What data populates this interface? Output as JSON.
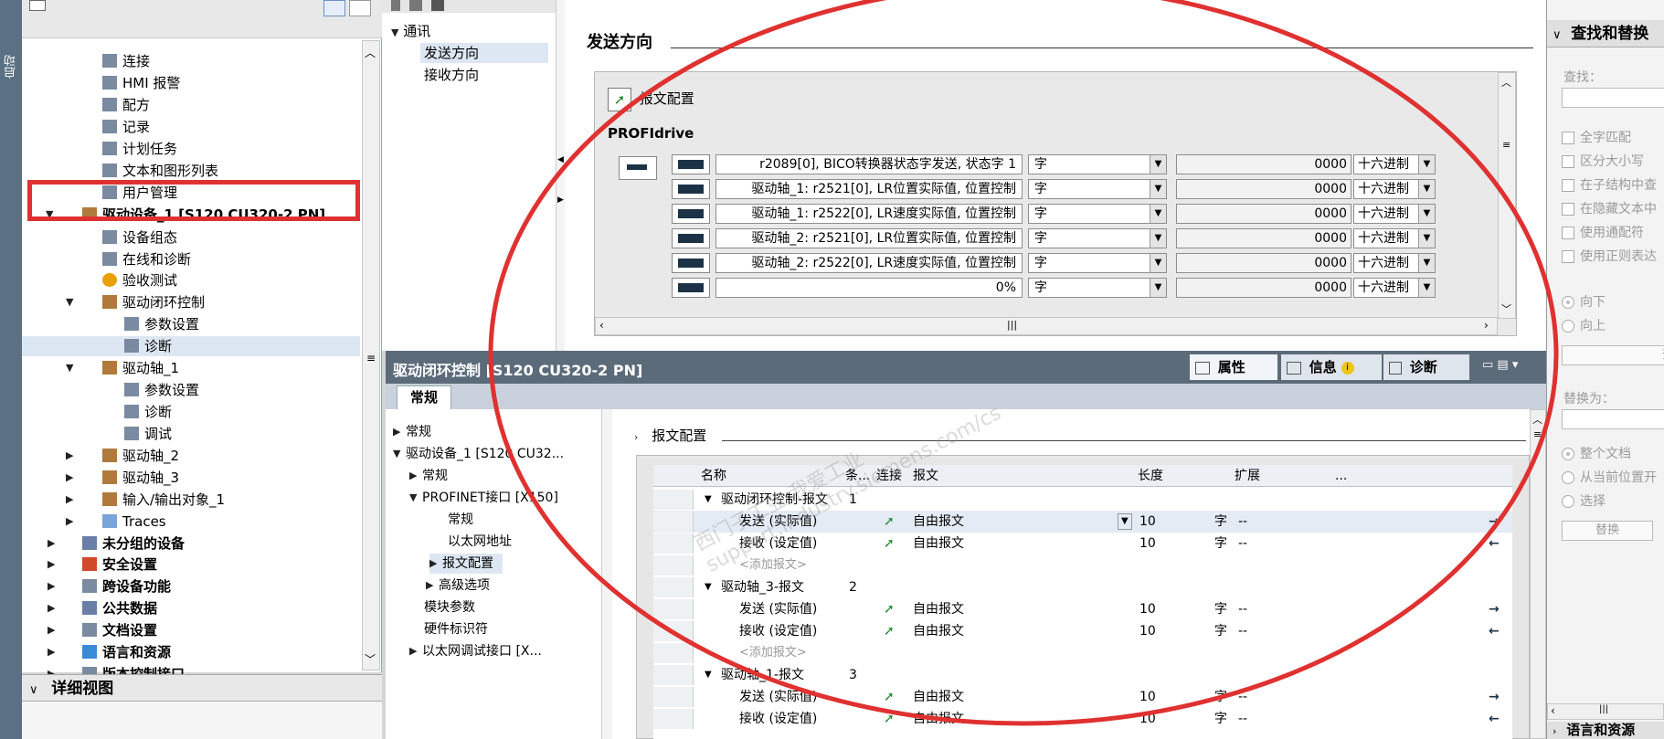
{
  "left_strip": {
    "label": "启动"
  },
  "tree": {
    "items": [
      {
        "label": "连接",
        "icon": "connection-icon"
      },
      {
        "label": "HMI 报警",
        "icon": "alarm-icon"
      },
      {
        "label": "配方",
        "icon": "recipe-icon"
      },
      {
        "label": "记录",
        "icon": "log-icon"
      },
      {
        "label": "计划任务",
        "icon": "schedule-icon"
      },
      {
        "label": "文本和图形列表",
        "icon": "textlist-icon"
      },
      {
        "label": "用户管理",
        "icon": "user-icon"
      },
      {
        "label": "驱动设备_1 [S120 CU320-2 PN]",
        "icon": "drive-device-icon"
      },
      {
        "label": "设备组态",
        "icon": "device-config-icon"
      },
      {
        "label": "在线和诊断",
        "icon": "online-diag-icon"
      },
      {
        "label": "验收测试",
        "icon": "acceptance-test-icon"
      },
      {
        "label": "驱动闭环控制",
        "icon": "drive-control-icon"
      },
      {
        "label": "参数设置",
        "icon": "parameter-icon"
      },
      {
        "label": "诊断",
        "icon": "diagnostics-icon"
      },
      {
        "label": "驱动轴_1",
        "icon": "drive-axis-icon"
      },
      {
        "label": "参数设置",
        "icon": "parameter-icon"
      },
      {
        "label": "诊断",
        "icon": "diagnostics-icon"
      },
      {
        "label": "调试",
        "icon": "commissioning-icon"
      },
      {
        "label": "驱动轴_2",
        "icon": "drive-axis-icon"
      },
      {
        "label": "驱动轴_3",
        "icon": "drive-axis-icon"
      },
      {
        "label": "输入/输出对象_1",
        "icon": "io-object-icon"
      },
      {
        "label": "Traces",
        "icon": "trace-icon"
      },
      {
        "label": "未分组的设备",
        "icon": "ungrouped-icon"
      },
      {
        "label": "安全设置",
        "icon": "security-icon"
      },
      {
        "label": "跨设备功能",
        "icon": "cross-device-icon"
      },
      {
        "label": "公共数据",
        "icon": "common-data-icon"
      },
      {
        "label": "文档设置",
        "icon": "document-settings-icon"
      },
      {
        "label": "语言和资源",
        "icon": "language-icon"
      },
      {
        "label": "版本控制接口",
        "icon": "version-control-icon"
      }
    ],
    "detail_view": "详细视图"
  },
  "mid_nav": {
    "root": "通讯",
    "items": [
      "发送方向",
      "接收方向"
    ]
  },
  "editor": {
    "title": "发送方向",
    "telegram_config_button": "报文配置",
    "profidrive_label": "PROFIdrive",
    "rows": [
      {
        "signal": "r2089[0], BICO转换器状态字发送, 状态字 1",
        "type": "字",
        "value": "0000",
        "format": "十六进制"
      },
      {
        "signal": "驱动轴_1: r2521[0], LR位置实际值, 位置控制",
        "type": "字",
        "value": "0000",
        "format": "十六进制"
      },
      {
        "signal": "驱动轴_1: r2522[0], LR速度实际值, 位置控制",
        "type": "字",
        "value": "0000",
        "format": "十六进制"
      },
      {
        "signal": "驱动轴_2: r2521[0], LR位置实际值, 位置控制",
        "type": "字",
        "value": "0000",
        "format": "十六进制"
      },
      {
        "signal": "驱动轴_2: r2522[0], LR速度实际值, 位置控制",
        "type": "字",
        "value": "0000",
        "format": "十六进制"
      },
      {
        "signal": "0%",
        "type": "字",
        "value": "0000",
        "format": "十六进制"
      }
    ]
  },
  "properties": {
    "title": "驱动闭环控制 [S120 CU320-2 PN]",
    "tabs": [
      "属性",
      "信息",
      "诊断"
    ],
    "subtab": "常规",
    "nav": [
      "常规",
      "驱动设备_1 [S120 CU32...",
      "常规",
      "PROFINET接口 [X150]",
      "常规",
      "以太网地址",
      "报文配置",
      "高级选项",
      "模块参数",
      "硬件标识符",
      "以太网调试接口 [X..."
    ],
    "section_title": "报文配置",
    "columns": [
      "名称",
      "条...",
      "连接",
      "报文",
      "长度",
      "扩展",
      "..."
    ],
    "rows": [
      {
        "name": "驱动闭环控制-报文",
        "num": "1",
        "telegram": "",
        "len": "",
        "unit": "",
        "ext": "",
        "dir": "",
        "group": true
      },
      {
        "name": "发送 (实际值)",
        "num": "",
        "telegram": "自由报文",
        "len": "10",
        "unit": "字",
        "ext": "--",
        "dir": "→",
        "group": false,
        "selected": true
      },
      {
        "name": "接收 (设定值)",
        "num": "",
        "telegram": "自由报文",
        "len": "10",
        "unit": "字",
        "ext": "--",
        "dir": "←",
        "group": false
      },
      {
        "name": "<添加报文>",
        "num": "",
        "telegram": "",
        "len": "",
        "unit": "",
        "ext": "",
        "dir": "",
        "group": false,
        "add": true
      },
      {
        "name": "驱动轴_3-报文",
        "num": "2",
        "telegram": "",
        "len": "",
        "unit": "",
        "ext": "",
        "dir": "",
        "group": true
      },
      {
        "name": "发送 (实际值)",
        "num": "",
        "telegram": "自由报文",
        "len": "10",
        "unit": "字",
        "ext": "--",
        "dir": "→",
        "group": false
      },
      {
        "name": "接收 (设定值)",
        "num": "",
        "telegram": "自由报文",
        "len": "10",
        "unit": "字",
        "ext": "--",
        "dir": "←",
        "group": false
      },
      {
        "name": "<添加报文>",
        "num": "",
        "telegram": "",
        "len": "",
        "unit": "",
        "ext": "",
        "dir": "",
        "group": false,
        "add": true
      },
      {
        "name": "驱动轴_1-报文",
        "num": "3",
        "telegram": "",
        "len": "",
        "unit": "",
        "ext": "",
        "dir": "",
        "group": true
      },
      {
        "name": "发送 (实际值)",
        "num": "",
        "telegram": "自由报文",
        "len": "10",
        "unit": "字",
        "ext": "--",
        "dir": "→",
        "group": false
      },
      {
        "name": "接收 (设定值)",
        "num": "",
        "telegram": "自由报文",
        "len": "10",
        "unit": "字",
        "ext": "--",
        "dir": "←",
        "group": false
      }
    ]
  },
  "find_replace": {
    "title": "查找和替换",
    "find_label": "查找：",
    "options": [
      "全字匹配",
      "区分大小写",
      "在子结构中查",
      "在隐藏文本中",
      "使用通配符",
      "使用正则表达"
    ],
    "direction": [
      "向下",
      "向上"
    ],
    "find_button": "查",
    "replace_label": "替换为：",
    "scope": [
      "整个文档",
      "从当前位置开",
      "选择"
    ],
    "replace_button": "替换",
    "bottom_section": "语言和资源"
  },
  "watermark": {
    "text": "西门子工业 我爱工业 support.industry.siemens.com/cs"
  },
  "colors": {
    "highlight_red": "#e03131",
    "title_bar": "#5c6b7a",
    "send_arrow": "#1e8a2e"
  }
}
